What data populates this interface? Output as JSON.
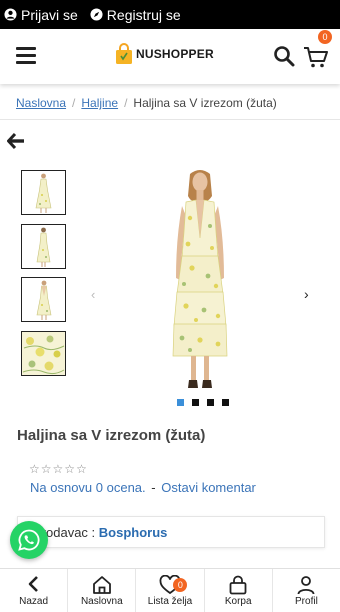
{
  "topbar": {
    "login_label": "Prijavi se",
    "register_label": "Registruj se"
  },
  "header": {
    "logo_text": "NUSHOPPER",
    "cart_count": "0"
  },
  "breadcrumb": {
    "items": [
      "Naslovna",
      "Haljine"
    ],
    "current": "Haljina sa V izrezom (žuta)"
  },
  "gallery": {
    "thumbnail_count": 4,
    "active_slide": 1,
    "slide_count": 4
  },
  "product": {
    "title": "Haljina sa V izrezom (žuta)",
    "rating_stars": "☆☆☆☆☆",
    "rating_text": "Na osnovu 0 ocena.",
    "rating_separator": "-",
    "review_link": "Ostavi komentar",
    "seller_label": "Prodavac :",
    "seller_name": "Bosphorus"
  },
  "bottom_nav": {
    "items": [
      {
        "label": "Nazad",
        "icon": "back-icon"
      },
      {
        "label": "Naslovna",
        "icon": "home-icon"
      },
      {
        "label": "Lista želja",
        "icon": "heart-icon",
        "badge": "0"
      },
      {
        "label": "Korpa",
        "icon": "bag-icon"
      },
      {
        "label": "Profil",
        "icon": "user-icon"
      }
    ]
  },
  "colors": {
    "accent_link": "#3b74b8",
    "badge": "#f26522",
    "whatsapp": "#25d366",
    "topbar": "#000000"
  }
}
